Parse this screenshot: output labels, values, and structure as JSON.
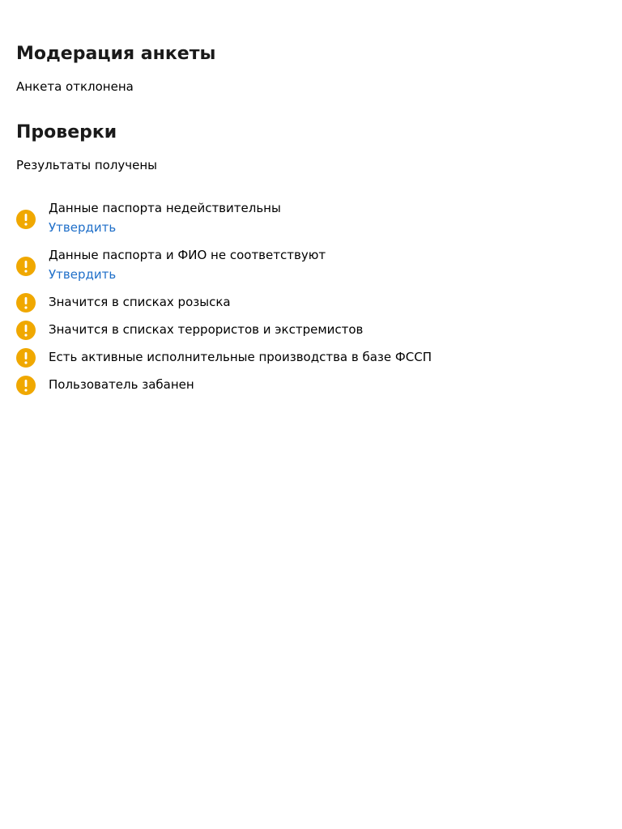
{
  "moderation": {
    "title": "Модерация анкеты",
    "status": "Анкета отклонена"
  },
  "checks": {
    "title": "Проверки",
    "status": "Результаты получены",
    "items": [
      {
        "icon": "warning-icon",
        "text": "Данные паспорта недействительны",
        "action": "Утвердить"
      },
      {
        "icon": "warning-icon",
        "text": "Данные паспорта и ФИО не соответствуют",
        "action": "Утвердить"
      },
      {
        "icon": "warning-icon",
        "text": "Значится в списках розыска"
      },
      {
        "icon": "warning-icon",
        "text": "Значится в списках террористов и экстремистов"
      },
      {
        "icon": "warning-icon",
        "text": "Есть активные исполнительные производства в базе ФССП"
      },
      {
        "icon": "warning-icon",
        "text": "Пользователь забанен"
      }
    ]
  },
  "colors": {
    "warning": "#f0a800",
    "link": "#1f6fc9",
    "text": "#000000"
  }
}
